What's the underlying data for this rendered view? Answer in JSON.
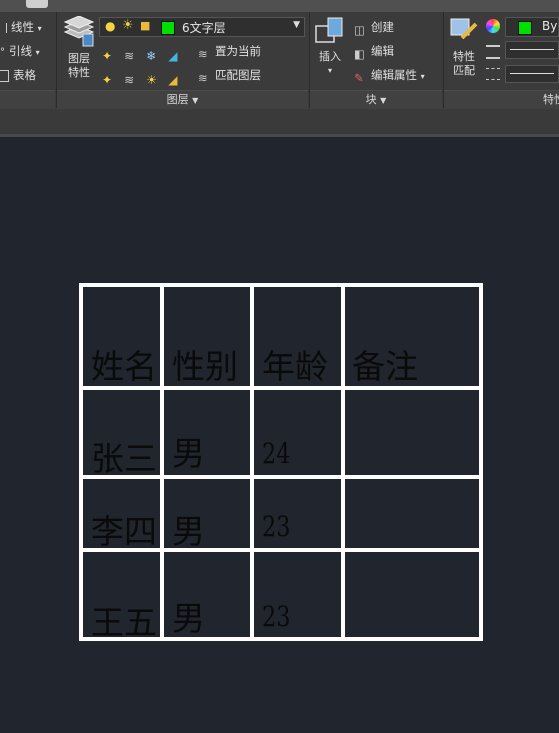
{
  "ribbon": {
    "left": {
      "linetype": "线性",
      "leader": "引线",
      "table": "表格"
    },
    "layer_props_button": {
      "line1": "图层",
      "line2": "特性"
    },
    "current_layer": {
      "name": "6文字层",
      "color": "#00e000"
    },
    "set_current": "置为当前",
    "match_layer": "匹配图层",
    "layers_panel_title": "图层",
    "insert_button": "插入",
    "create": "创建",
    "edit": "编辑",
    "edit_attributes": "编辑属性",
    "block_panel_title": "块",
    "match_props_button": {
      "line1": "特性",
      "line2": "匹配"
    },
    "bylayer": "By",
    "properties_panel_title": "特性"
  },
  "table": {
    "headers": [
      "姓名",
      "性别",
      "年龄",
      "备注"
    ],
    "rows": [
      [
        "张三",
        "男",
        "24",
        ""
      ],
      [
        "李四",
        "男",
        "23",
        ""
      ],
      [
        "王五",
        "男",
        "23",
        ""
      ]
    ]
  }
}
